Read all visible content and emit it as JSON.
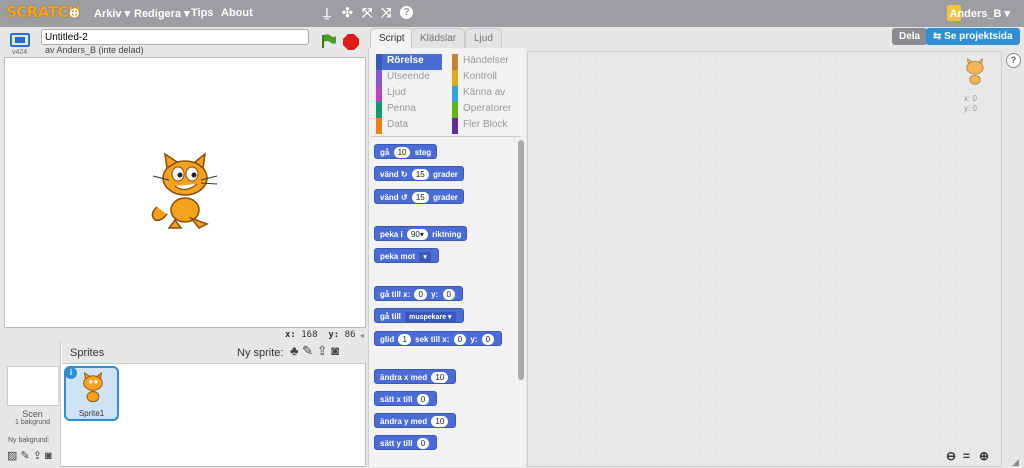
{
  "menubar": {
    "logo": "SCRATCH",
    "items": [
      "Arkiv ▾",
      "Redigera ▾",
      "Tips",
      "About"
    ],
    "user": "Anders_B ▾"
  },
  "stage": {
    "title_value": "Untitled-2",
    "author": "av Anders_B (inte delad)",
    "version": "v424",
    "coords_x_label": "x:",
    "coords_x": "168",
    "coords_y_label": "y:",
    "coords_y": "86"
  },
  "sprites": {
    "header": "Sprites",
    "new_sprite": "Ny sprite:",
    "scene_label": "Scen",
    "scene_sub": "1 bakgrund",
    "new_backdrop": "Ny bakgrund:",
    "sprite1": "Sprite1"
  },
  "tabs": [
    "Script",
    "Klädslar",
    "Ljud"
  ],
  "categories": [
    {
      "label": "Rörelse",
      "color": "#4a6cd4"
    },
    {
      "label": "Händelser",
      "color": "#c88330"
    },
    {
      "label": "Utseende",
      "color": "#8a55d7"
    },
    {
      "label": "Kontroll",
      "color": "#e1a91a"
    },
    {
      "label": "Ljud",
      "color": "#bb42c3"
    },
    {
      "label": "Känna av",
      "color": "#2ca5e2"
    },
    {
      "label": "Penna",
      "color": "#0e9a6c"
    },
    {
      "label": "Operatorer",
      "color": "#5cb712"
    },
    {
      "label": "Data",
      "color": "#ee7d16"
    },
    {
      "label": "Fler Block",
      "color": "#632d99"
    }
  ],
  "blocks": {
    "b1_pre": "gå",
    "b1_val": "10",
    "b1_post": "steg",
    "b2_pre": "vänd",
    "b2_val": "15",
    "b2_post": "grader",
    "b3_pre": "vänd",
    "b3_val": "15",
    "b3_post": "grader",
    "b4_pre": "peka i",
    "b4_val": "90▾",
    "b4_post": "riktning",
    "b5_pre": "peka mot",
    "b6_pre": "gå till x:",
    "b6_x": "0",
    "b6_mid": "y:",
    "b6_y": "0",
    "b7_pre": "gå till",
    "b7_dd": "muspekare ▾",
    "b8_pre": "glid",
    "b8_val": "1",
    "b8_mid": "sek till x:",
    "b8_x": "0",
    "b8_mid2": "y:",
    "b8_y": "0",
    "b9_pre": "ändra x med",
    "b9_val": "10",
    "b10_pre": "sätt x till",
    "b10_val": "0",
    "b11_pre": "ändra y med",
    "b11_val": "10",
    "b12_pre": "sätt y till",
    "b12_val": "0"
  },
  "buttons": {
    "share": "Dela",
    "project_page": "Se projektsida"
  },
  "sprite_info": {
    "x": "x: 0",
    "y": "y: 0"
  }
}
